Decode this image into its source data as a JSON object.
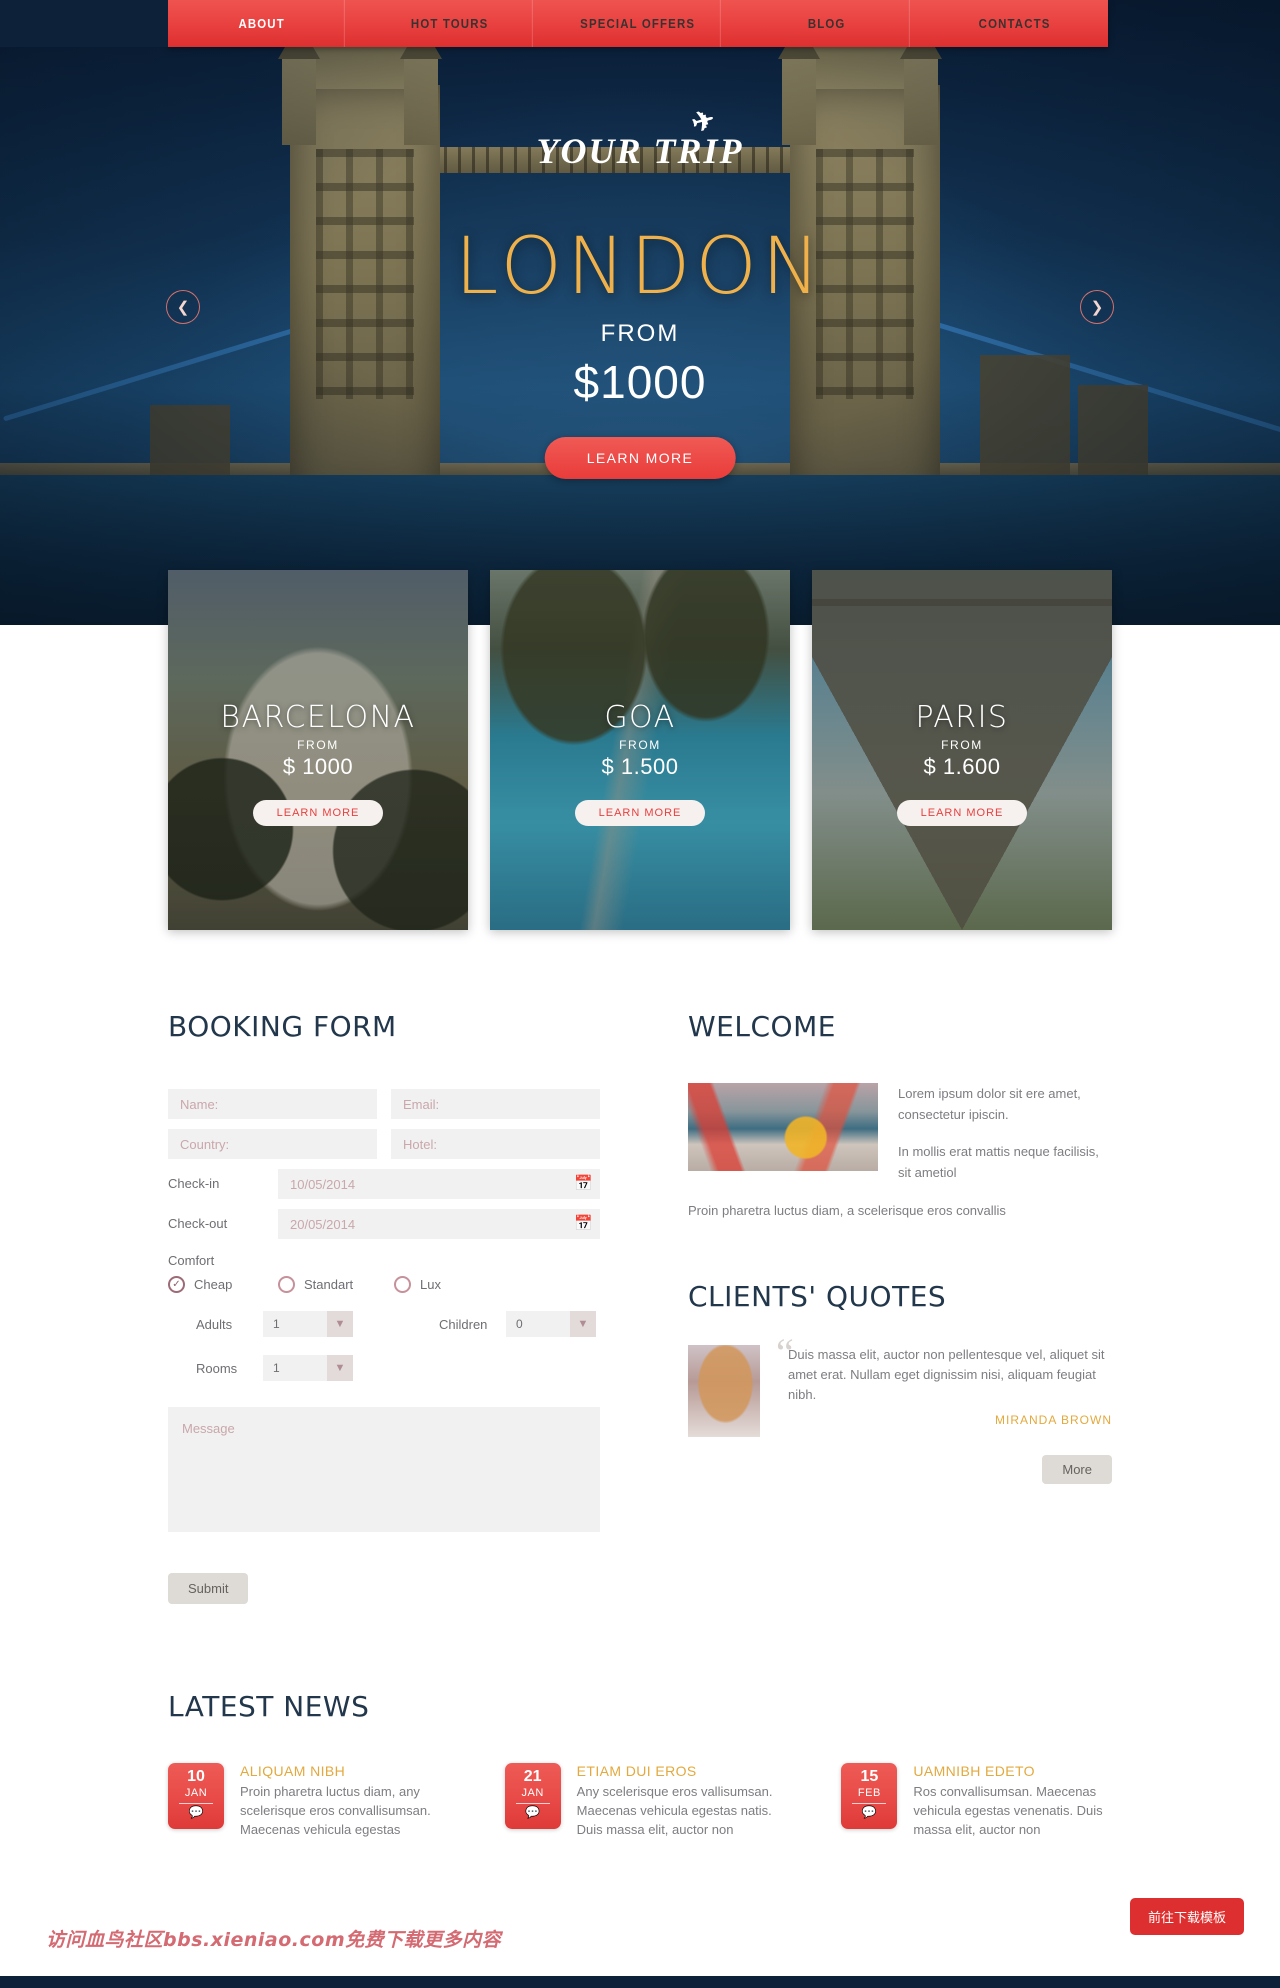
{
  "nav": {
    "items": [
      {
        "label": "ABOUT",
        "active": true
      },
      {
        "label": "HOT TOURS",
        "active": false
      },
      {
        "label": "SPECIAL OFFERS",
        "active": false
      },
      {
        "label": "BLOG",
        "active": false
      },
      {
        "label": "CONTACTS",
        "active": false
      }
    ]
  },
  "hero": {
    "logo": "YOUR TRIP",
    "plane_icon": "airplane-icon",
    "city": "LONDON",
    "from_label": "FROM",
    "price": "$1000",
    "cta": "LEARN MORE",
    "prev_icon": "chevron-left-icon",
    "next_icon": "chevron-right-icon"
  },
  "cards": [
    {
      "title": "BARCELONA",
      "from_label": "FROM",
      "price": "$ 1000",
      "cta": "LEARN MORE"
    },
    {
      "title": "GOA",
      "from_label": "FROM",
      "price": "$ 1.500",
      "cta": "LEARN MORE"
    },
    {
      "title": "PARIS",
      "from_label": "FROM",
      "price": "$ 1.600",
      "cta": "LEARN MORE"
    }
  ],
  "booking": {
    "title": "BOOKING FORM",
    "name_placeholder": "Name:",
    "email_placeholder": "Email:",
    "country_placeholder": "Country:",
    "hotel_placeholder": "Hotel:",
    "checkin_label": "Check-in",
    "checkin_value": "10/05/2014",
    "checkout_label": "Check-out",
    "checkout_value": "20/05/2014",
    "calendar_icon": "calendar-icon",
    "comfort_label": "Comfort",
    "comfort_options": [
      {
        "label": "Cheap",
        "selected": true
      },
      {
        "label": "Standart",
        "selected": false
      },
      {
        "label": "Lux",
        "selected": false
      }
    ],
    "adults_label": "Adults",
    "adults_value": "1",
    "children_label": "Children",
    "children_value": "0",
    "rooms_label": "Rooms",
    "rooms_value": "1",
    "message_placeholder": "Message",
    "submit_label": "Submit"
  },
  "welcome": {
    "title": "WELCOME",
    "para1": "Lorem ipsum dolor sit ere amet, consectetur ipiscin.",
    "para2": "In mollis erat mattis neque facilisis, sit ametiol",
    "para3": "Proin pharetra luctus diam, a scelerisque eros convallis"
  },
  "quotes": {
    "title": "CLIENTS' QUOTES",
    "text": "Duis massa elit, auctor non pellentesque vel, aliquet sit amet erat. Nullam eget dignissim nisi, aliquam feugiat nibh.",
    "author": "MIRANDA BROWN",
    "more_label": "More"
  },
  "news": {
    "title": "LATEST NEWS",
    "items": [
      {
        "day": "10",
        "month": "JAN",
        "comment_icon": "comment-icon",
        "title": "ALIQUAM NIBH",
        "desc": "Proin pharetra luctus diam, any scelerisque eros convallisumsan. Maecenas vehicula egestas"
      },
      {
        "day": "21",
        "month": "JAN",
        "comment_icon": "comment-icon",
        "title": "ETIAM DUI EROS",
        "desc": "Any scelerisque eros vallisumsan. Maecenas vehicula egestas natis. Duis massa elit, auctor non"
      },
      {
        "day": "15",
        "month": "FEB",
        "comment_icon": "comment-icon",
        "title": "UAMNIBH EDETO",
        "desc": "Ros convallisumsan. Maecenas vehicula egestas venenatis. Duis massa elit, auctor non"
      }
    ]
  },
  "overlay": {
    "watermark": "访问血鸟社区bbs.xieniao.com免费下载更多内容",
    "download_button": "前往下载模板"
  },
  "colors": {
    "brand_red": "#e8403f",
    "accent_gold": "#e3a93e",
    "hero_gold": "#f0b14a",
    "dark_navy": "#0d2238",
    "heading_navy": "#22374b"
  }
}
